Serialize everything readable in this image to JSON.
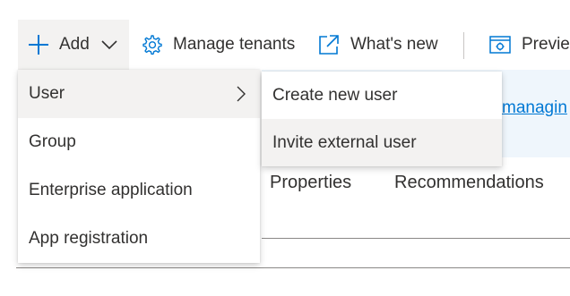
{
  "toolbar": {
    "add_label": "Add",
    "manage_tenants_label": "Manage tenants",
    "whats_new_label": "What's new",
    "preview_label": "Previe"
  },
  "background": {
    "info_link": "managin",
    "tabs": [
      "Properties",
      "Recommendations"
    ]
  },
  "add_menu": {
    "items": [
      "User",
      "Group",
      "Enterprise application",
      "App registration"
    ],
    "active_item": "User"
  },
  "user_submenu": {
    "items": [
      "Create new user",
      "Invite external user"
    ],
    "hovered_item": "Invite external user"
  },
  "colors": {
    "accent": "#0078d4",
    "hover_bg": "#f3f2f1",
    "info_bg": "#eff6fc",
    "text": "#323130"
  },
  "icons": {
    "add": "plus-icon",
    "add_dropdown": "chevron-down-icon",
    "manage_tenants": "gear-icon",
    "whats_new": "open-external-icon",
    "preview": "preview-settings-icon",
    "submenu": "chevron-right-icon"
  }
}
